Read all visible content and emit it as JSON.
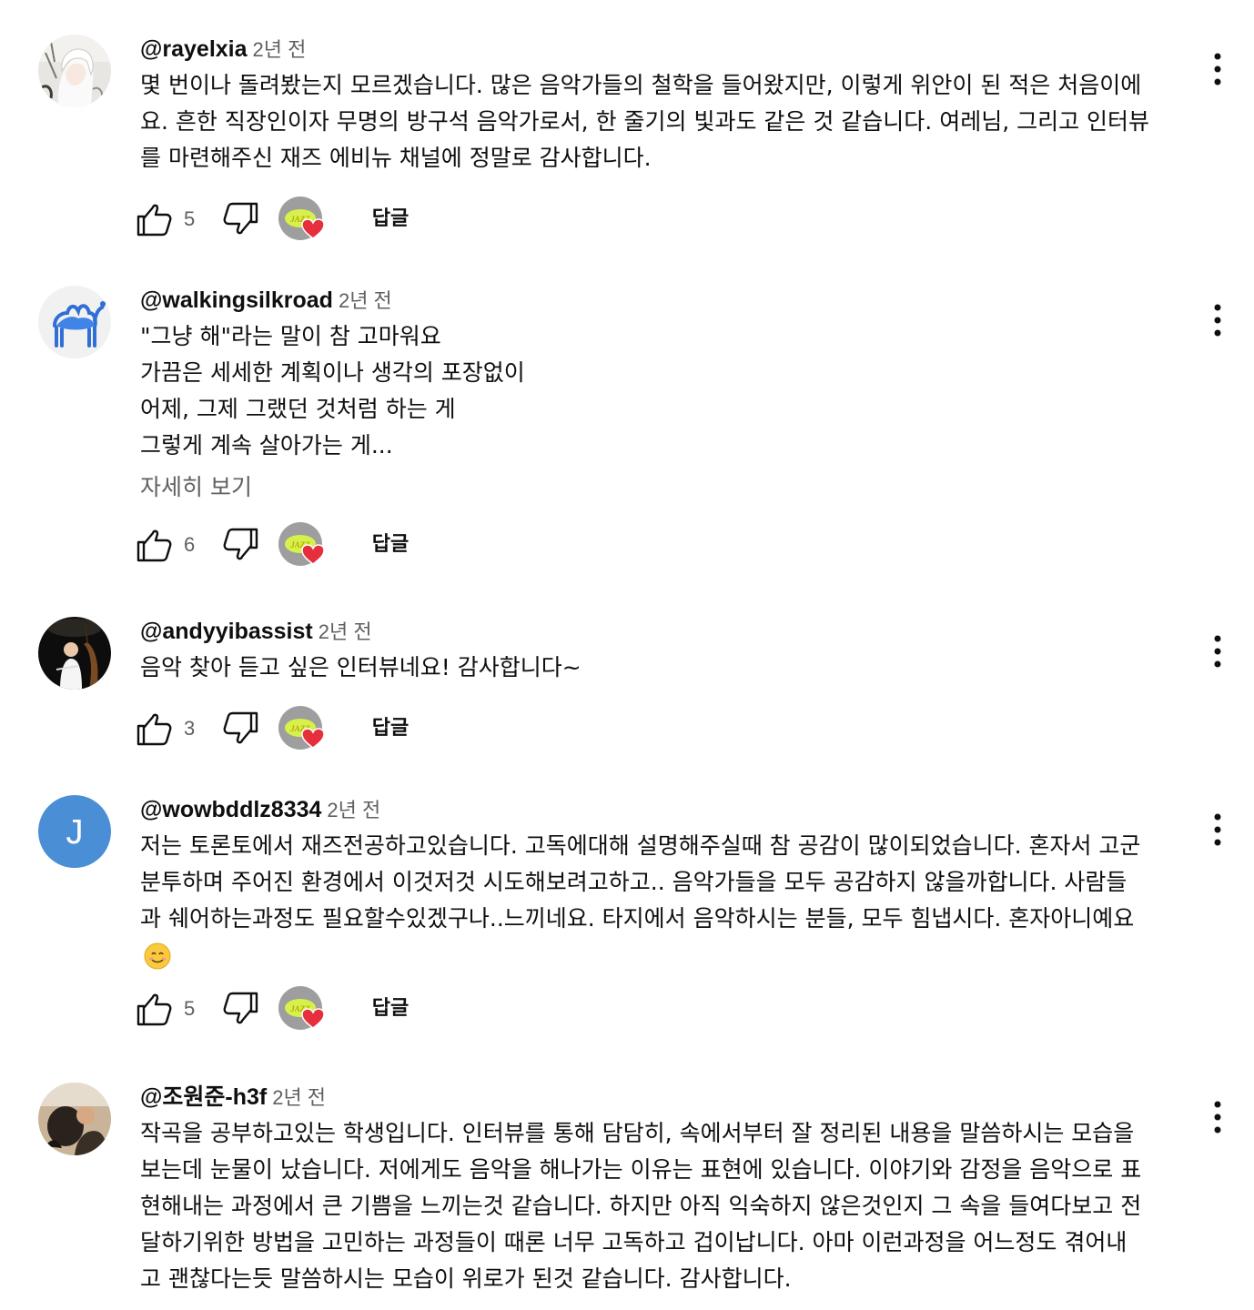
{
  "comments": [
    {
      "author": "@rayelxia",
      "time": "2년 전",
      "lines": [
        "몇 번이나 돌려봤는지 모르겠습니다. 많은 음악가들의 철학을 들어왔지만, 이렇게 위안이 된 적은 처음이에",
        "요. 흔한 직장인이자 무명의 방구석 음악가로서, 한 줄기의 빛과도 같은 것 같습니다. 여레님, 그리고 인터뷰",
        "를 마련해주신 재즈 에비뉴 채널에 정말로 감사합니다."
      ],
      "likes": "5",
      "reply_label": "답글",
      "avatar_icon": "anime-character-avatar"
    },
    {
      "author": "@walkingsilkroad",
      "time": "2년 전",
      "lines": [
        "\"그냥 해\"라는 말이 참 고마워요",
        "가끔은 세세한 계획이나 생각의 포장없이",
        "어제, 그제 그랬던 것처럼 하는 게",
        "그렇게 계속 살아가는 게..."
      ],
      "read_more": "자세히 보기",
      "likes": "6",
      "reply_label": "답글",
      "avatar_icon": "blue-camel-avatar"
    },
    {
      "author": "@andyyibassist",
      "time": "2년 전",
      "lines": [
        "음악 찾아 듣고 싶은 인터뷰네요! 감사합니다~"
      ],
      "likes": "3",
      "reply_label": "답글",
      "avatar_icon": "bassist-photo-avatar"
    },
    {
      "author": "@wowbddlz8334",
      "time": "2년 전",
      "lines": [
        "저는 토론토에서 재즈전공하고있습니다. 고독에대해 설명해주실때 참 공감이 많이되었습니다. 혼자서 고군",
        "분투하며 주어진 환경에서 이것저것 시도해보려고하고.. 음악가들을 모두 공감하지 않을까합니다. 사람들",
        "과 쉐어하는과정도 필요할수있겠구나..느끼네요. 타지에서 음악하시는 분들, 모두 힘냅시다. 혼자아니예요"
      ],
      "emoji": "smiling-face-emoji",
      "likes": "5",
      "reply_label": "답글",
      "avatar_letter": "J",
      "avatar_color": "#4a8fd6"
    },
    {
      "author": "@조원준-h3f",
      "time": "2년 전",
      "lines": [
        "작곡을 공부하고있는 학생입니다. 인터뷰를 통해 담담히, 속에서부터 잘 정리된 내용을 말씀하시는 모습을",
        "보는데 눈물이 났습니다. 저에게도 음악을 해나가는 이유는 표현에 있습니다. 이야기와 감정을 음악으로 표",
        "현해내는 과정에서 큰 기쁨을 느끼는것 같습니다. 하지만 아직 익숙하지 않은것인지 그 속을 들여다보고 전",
        "달하기위한 방법을 고민하는 과정들이 때론 너무 고독하고 겁이납니다. 아마 이런과정을 어느정도 겪어내",
        "고 괜찮다는듯 말씀하시는 모습이 위로가 된것 같습니다. 감사합니다."
      ],
      "avatar_icon": "dark-photo-avatar"
    }
  ],
  "icons": {
    "like": "thumbs-up-icon",
    "dislike": "thumbs-down-icon",
    "creator_heart": "creator-heart-icon",
    "menu": "more-vert-icon"
  },
  "colors": {
    "text": "#0f0f0f",
    "secondary": "#606060",
    "heart": "#e62e3d"
  }
}
